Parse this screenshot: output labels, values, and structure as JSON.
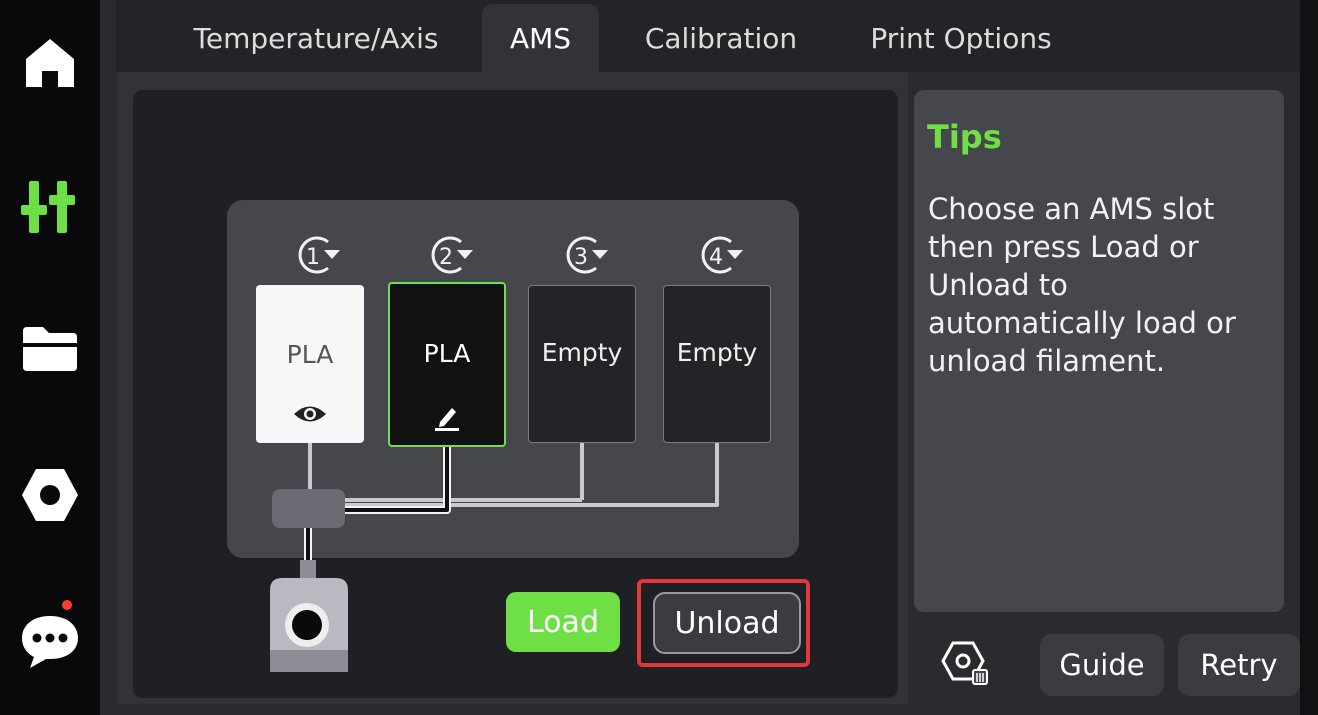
{
  "sidebar": {
    "items": [
      {
        "icon": "home-icon"
      },
      {
        "icon": "controls-icon",
        "color": "#6ee045"
      },
      {
        "icon": "folder-icon"
      },
      {
        "icon": "settings-icon"
      },
      {
        "icon": "message-icon",
        "notification": true
      }
    ]
  },
  "tabs": [
    {
      "label": "Temperature/Axis"
    },
    {
      "label": "AMS",
      "active": true
    },
    {
      "label": "Calibration"
    },
    {
      "label": "Print Options"
    }
  ],
  "ams": {
    "slots": [
      {
        "number": "1",
        "label": "PLA",
        "color": "#f7f7f7",
        "icon": "eye-icon"
      },
      {
        "number": "2",
        "label": "PLA",
        "color": "#111111",
        "icon": "edit-icon",
        "selected": true
      },
      {
        "number": "3",
        "label": "Empty"
      },
      {
        "number": "4",
        "label": "Empty"
      }
    ]
  },
  "actions": {
    "load_label": "Load",
    "unload_label": "Unload"
  },
  "tips": {
    "title": "Tips",
    "text": "Choose an AMS slot then press Load or Unload to automatically load or unload filament."
  },
  "footer": {
    "guide_label": "Guide",
    "retry_label": "Retry"
  },
  "colors": {
    "accent": "#6ee045",
    "highlight": "#e2383a"
  }
}
